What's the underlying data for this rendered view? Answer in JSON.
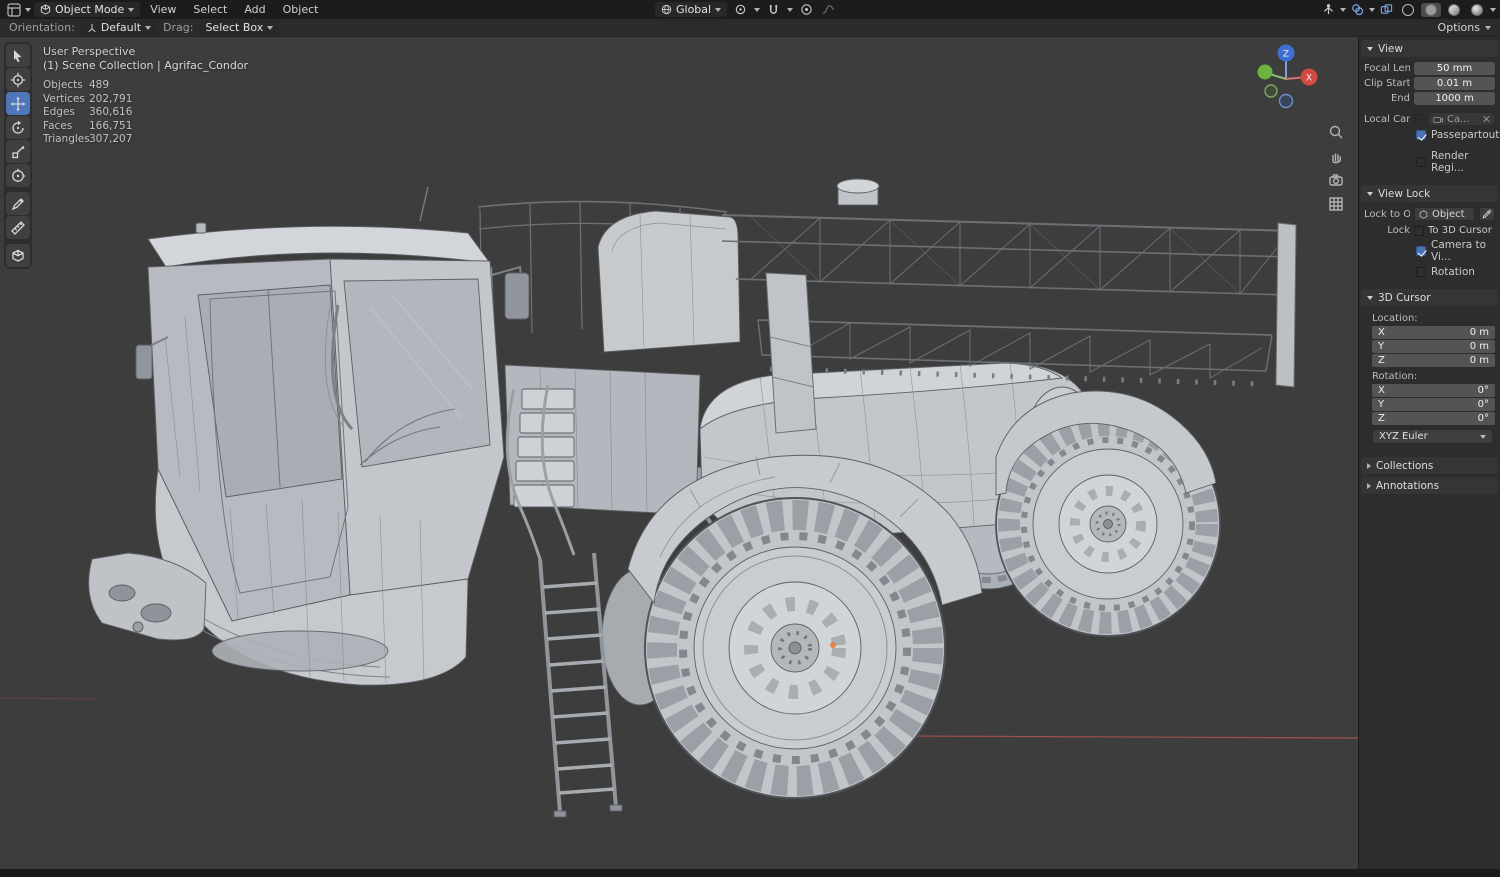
{
  "colors": {
    "accent": "#4772b3",
    "axis_x": "#d04a42",
    "axis_y": "#6cb33f",
    "axis_z": "#3f6fd0",
    "viewport_bg": "#3d3d3d"
  },
  "topbar": {
    "mode_label": "Object Mode",
    "menus": [
      {
        "label": "View"
      },
      {
        "label": "Select"
      },
      {
        "label": "Add"
      },
      {
        "label": "Object"
      }
    ],
    "orientation_label": "Global"
  },
  "tool_header": {
    "orientation_label": "Orientation:",
    "orientation_value": "Default",
    "drag_label": "Drag:",
    "drag_value": "Select Box",
    "options_label": "Options"
  },
  "viewport": {
    "view_name": "User Perspective",
    "collection_path": "(1) Scene Collection | Agrifac_Condor",
    "stats": [
      {
        "label": "Objects",
        "value": "489"
      },
      {
        "label": "Vertices",
        "value": "202,791"
      },
      {
        "label": "Edges",
        "value": "360,616"
      },
      {
        "label": "Faces",
        "value": "166,751"
      },
      {
        "label": "Triangles",
        "value": "307,207"
      }
    ],
    "gizmo": {
      "x_label": "X",
      "z_label": "Z"
    }
  },
  "sidebar": {
    "view_panel": {
      "title": "View",
      "focal_label": "Focal Len...",
      "focal_value": "50 mm",
      "clip_start_label": "Clip Start",
      "clip_start_value": "0.01 m",
      "clip_end_label": "End",
      "clip_end_value": "1000 m",
      "local_camera_label": "Local Cam...",
      "local_camera_value": "Ca...",
      "passepartout_label": "Passepartout",
      "render_region_label": "Render Regi..."
    },
    "view_lock_panel": {
      "title": "View Lock",
      "lock_to_label": "Lock to O...",
      "lock_to_value": "Object",
      "lock_label": "Lock",
      "to_3d_cursor_label": "To 3D Cursor",
      "camera_to_view_label": "Camera to Vi...",
      "rotation_label": "Rotation"
    },
    "cursor_panel": {
      "title": "3D Cursor",
      "location_label": "Location:",
      "rotation_label": "Rotation:",
      "location": [
        {
          "axis": "X",
          "value": "0 m"
        },
        {
          "axis": "Y",
          "value": "0 m"
        },
        {
          "axis": "Z",
          "value": "0 m"
        }
      ],
      "rotation": [
        {
          "axis": "X",
          "value": "0°"
        },
        {
          "axis": "Y",
          "value": "0°"
        },
        {
          "axis": "Z",
          "value": "0°"
        }
      ],
      "euler_mode": "XYZ Euler"
    },
    "collections_title": "Collections",
    "annotations_title": "Annotations"
  }
}
